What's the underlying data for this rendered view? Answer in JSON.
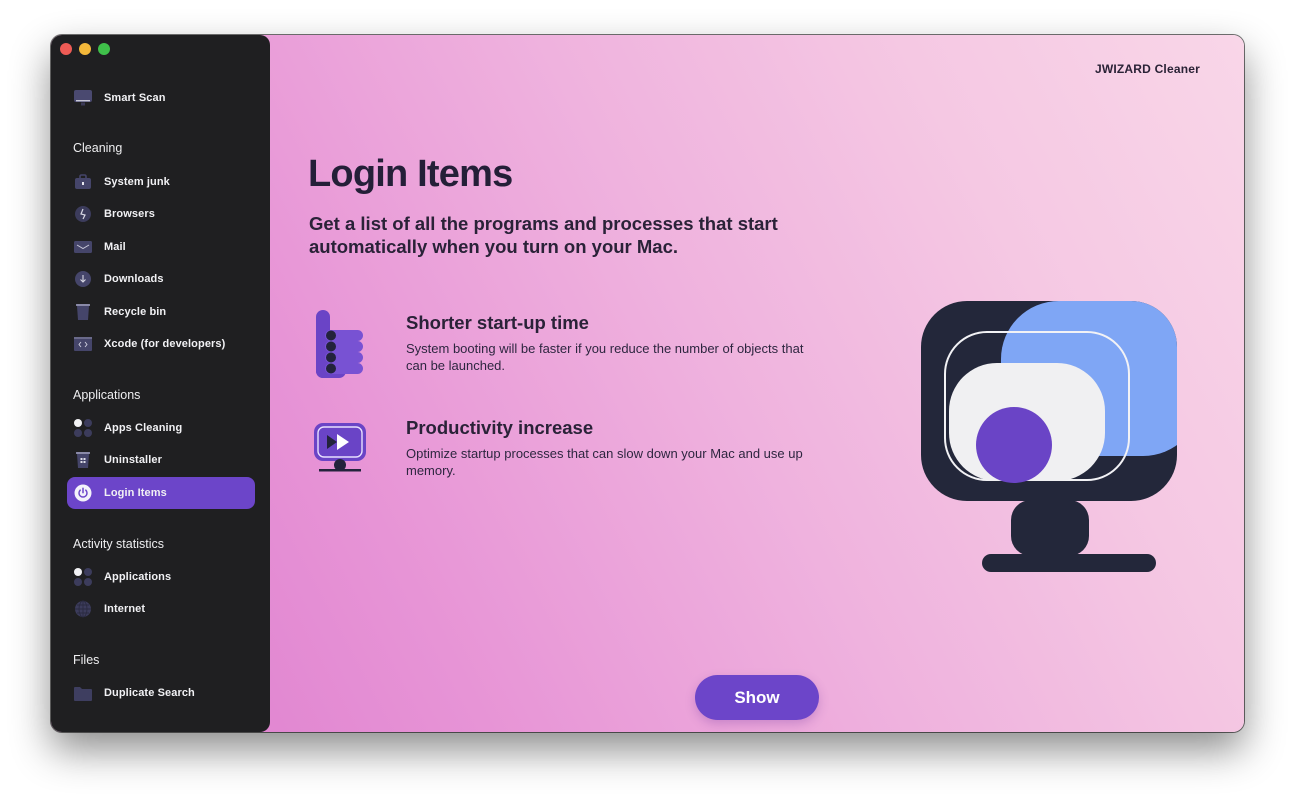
{
  "window": {
    "controls": [
      "close",
      "minimize",
      "zoom"
    ]
  },
  "sidebar": {
    "top_item": {
      "label": "Smart Scan",
      "icon": "monitor-icon"
    },
    "sections": [
      {
        "title": "Cleaning",
        "items": [
          {
            "label": "System junk",
            "icon": "briefcase-icon"
          },
          {
            "label": "Browsers",
            "icon": "compass-icon"
          },
          {
            "label": "Mail",
            "icon": "envelope-icon"
          },
          {
            "label": "Downloads",
            "icon": "download-icon"
          },
          {
            "label": "Recycle bin",
            "icon": "trash-icon"
          },
          {
            "label": "Xcode (for developers)",
            "icon": "code-icon"
          }
        ]
      },
      {
        "title": "Applications",
        "items": [
          {
            "label": "Apps Cleaning",
            "icon": "apps-grid-icon"
          },
          {
            "label": "Uninstaller",
            "icon": "uninstall-bin-icon"
          },
          {
            "label": "Login Items",
            "icon": "power-icon",
            "active": true
          }
        ]
      },
      {
        "title": "Activity statistics",
        "items": [
          {
            "label": "Applications",
            "icon": "apps-grid-icon"
          },
          {
            "label": "Internet",
            "icon": "globe-icon"
          }
        ]
      },
      {
        "title": "Files",
        "items": [
          {
            "label": "Duplicate Search",
            "icon": "folder-icon"
          }
        ]
      }
    ]
  },
  "main": {
    "brand": "JWIZARD Cleaner",
    "title": "Login Items",
    "subtitle": "Get a list of all the programs and processes that start automatically when you turn on your Mac.",
    "features": [
      {
        "title": "Shorter start-up time",
        "description": "System booting will be faster if you reduce the number of objects that can be launched.",
        "icon": "thumbs-up-icon"
      },
      {
        "title": "Productivity increase",
        "description": "Optimize startup processes that can slow down your Mac and use up memory.",
        "icon": "monitor-play-icon"
      }
    ],
    "action_button": "Show"
  },
  "colors": {
    "accent": "#6c45c9",
    "sidebar_bg": "#1f1f21",
    "text_dark": "#241f38",
    "illustration_blue": "#7fa6f5",
    "illustration_navy": "#23273a",
    "illustration_white": "#f0f0f2"
  }
}
